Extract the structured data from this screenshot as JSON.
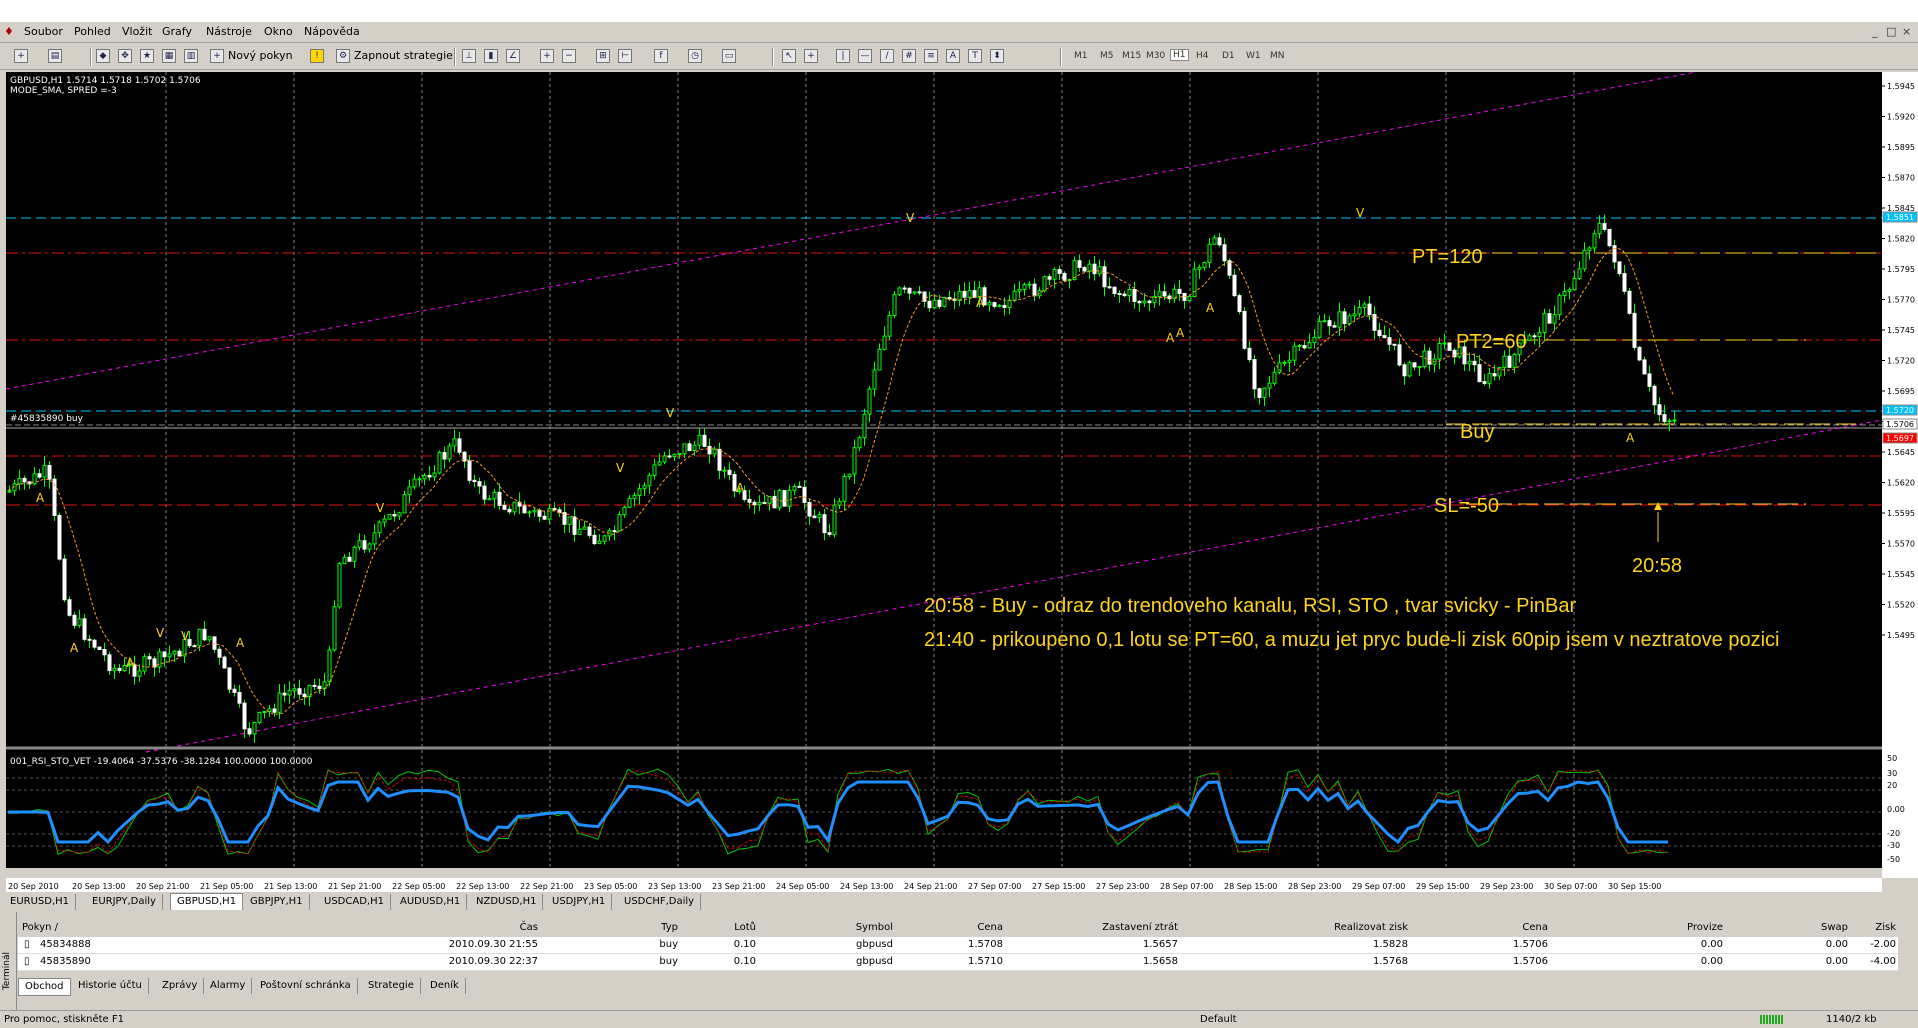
{
  "menu": [
    "Soubor",
    "Pohled",
    "Vložit",
    "Grafy",
    "Nástroje",
    "Okno",
    "Nápověda"
  ],
  "window_controls": [
    "_",
    "□",
    "×"
  ],
  "toolbar": {
    "new_order_label": "Nový pokyn",
    "strategy_label": "Zapnout strategie",
    "timeframes": [
      "M1",
      "M5",
      "M15",
      "M30",
      "H1",
      "H4",
      "D1",
      "W1",
      "MN"
    ],
    "selected_timeframe": "H1"
  },
  "chart": {
    "info_line1": "GBPUSD,H1  1.5714 1.5718 1.5702 1.5706",
    "info_line2": "MODE_SMA, SPRED =-3",
    "order_tag": "#45835890 buy",
    "annotations": {
      "pt": "PT=120",
      "pt2": "PT2=60",
      "buy": "Buy",
      "sl": "SL=-50",
      "time": "20:58",
      "note1": "20:58 - Buy - odraz do trendoveho kanalu, RSI, STO  , tvar svicky - PinBar",
      "note2": "21:40 - prikoupeno 0,1 lotu se PT=60, a muzu jet pryc bude-li zisk 60pip jsem v neztratove pozici"
    },
    "price_ticks": [
      "1.5945",
      "1.5920",
      "1.5895",
      "1.5870",
      "1.5845",
      "1.5820",
      "1.5795",
      "1.5770",
      "1.5745",
      "1.5720",
      "1.5695",
      "1.5670",
      "1.5645",
      "1.5620",
      "1.5595",
      "1.5570",
      "1.5545",
      "1.5520",
      "1.5495"
    ],
    "price_flags": [
      {
        "label": "1.5851",
        "bg": "#00c0ff"
      },
      {
        "label": "1.5720",
        "bg": "#00c0ff"
      },
      {
        "label": "1.5706",
        "bg": "#ffffff"
      },
      {
        "label": "1.5697",
        "bg": "#ff0000"
      }
    ],
    "indicator_label": "001_RSI_STO_VET -19.4064 -37.5376 -38.1284 100.0000 100.0000",
    "indicator_ticks": [
      "50",
      "30",
      "20",
      "0.00",
      "-20",
      "-30",
      "-50"
    ],
    "time_ticks": [
      "20 Sep 2010",
      "20 Sep 13:00",
      "20 Sep 21:00",
      "21 Sep 05:00",
      "21 Sep 13:00",
      "21 Sep 21:00",
      "22 Sep 05:00",
      "22 Sep 13:00",
      "22 Sep 21:00",
      "23 Sep 05:00",
      "23 Sep 13:00",
      "23 Sep 21:00",
      "24 Sep 05:00",
      "24 Sep 13:00",
      "24 Sep 21:00",
      "27 Sep 07:00",
      "27 Sep 15:00",
      "27 Sep 23:00",
      "28 Sep 07:00",
      "28 Sep 15:00",
      "28 Sep 23:00",
      "29 Sep 07:00",
      "29 Sep 15:00",
      "29 Sep 23:00",
      "30 Sep 07:00",
      "30 Sep 15:00"
    ]
  },
  "chart_tabs": [
    "EURUSD,H1",
    "EURJPY,Daily",
    "GBPUSD,H1",
    "GBPJPY,H1",
    "USDCAD,H1",
    "AUDUSD,H1",
    "NZDUSD,H1",
    "USDJPY,H1",
    "USDCHF,Daily"
  ],
  "active_chart_tab": 2,
  "terminal": {
    "side_label": "Terminál",
    "columns": [
      "Pokyn  /",
      "Čas",
      "Typ",
      "Lotů",
      "Symbol",
      "Cena",
      "Zastavení ztrát",
      "Realizovat zisk",
      "Cena",
      "Provize",
      "Swap",
      "Zisk"
    ],
    "rows": [
      [
        "45834888",
        "2010.09.30 21:55",
        "buy",
        "0.10",
        "gbpusd",
        "1.5708",
        "1.5657",
        "1.5828",
        "1.5706",
        "0.00",
        "0.00",
        "-2.00"
      ],
      [
        "45835890",
        "2010.09.30 22:37",
        "buy",
        "0.10",
        "gbpusd",
        "1.5710",
        "1.5658",
        "1.5768",
        "1.5706",
        "0.00",
        "0.00",
        "-4.00"
      ]
    ],
    "bottom_tabs": [
      "Obchod",
      "Historie účtu",
      "Zprávy",
      "Alarmy",
      "Poštovní schránka",
      "Strategie",
      "Deník"
    ],
    "active_bottom_tab": 0
  },
  "status": {
    "help": "Pro pomoc, stiskněte F1",
    "profile": "Default",
    "traffic": "1140/2 kb"
  },
  "colors": {
    "bull": "#00ff00",
    "bear": "#ffffff",
    "annotation": "#ffd21e",
    "channel": "#ff00ff",
    "rsi": "#1e90ff"
  }
}
